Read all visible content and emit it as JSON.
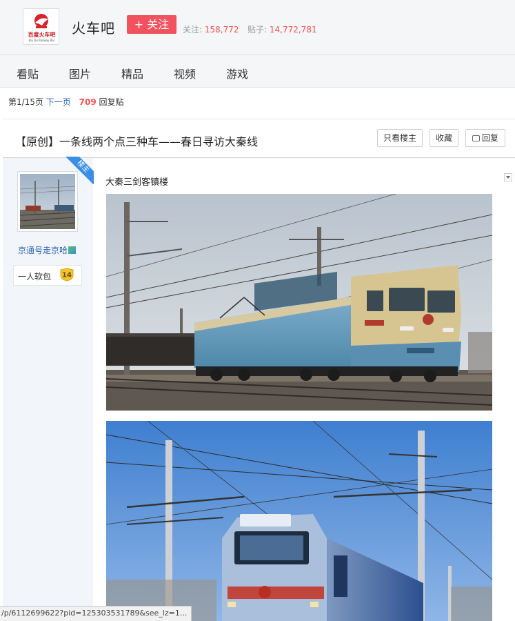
{
  "header": {
    "logo_text": "百度火车吧",
    "logo_subtext": "Bai Du Railway Bar",
    "forum_name": "火车吧",
    "follow_label": "+ 关注",
    "followers_label": "关注:",
    "followers_count": "158,772",
    "posts_label": "贴子:",
    "posts_count": "14,772,781"
  },
  "nav": {
    "items": [
      {
        "label": "看贴"
      },
      {
        "label": "图片"
      },
      {
        "label": "精品"
      },
      {
        "label": "视频"
      },
      {
        "label": "游戏"
      }
    ]
  },
  "pager": {
    "page_info": "第1/15页",
    "next_page": "下一页",
    "reply_count": "709",
    "reply_label": "回复贴"
  },
  "thread": {
    "title": "【原创】一条线两个点三种车——春日寻访大秦线",
    "only_op_label": "只看楼主",
    "favorite_label": "收藏",
    "reply_label": "回复"
  },
  "author": {
    "floor_tag": "楼主",
    "name": "京通号走京哈",
    "level_name": "一人软包",
    "level": "14"
  },
  "post": {
    "caption": "大秦三剑客镇楼"
  },
  "status_bar": {
    "url": "/p/6112699622?pid=125303531789&see_lz=1..."
  },
  "colors": {
    "accent_red": "#f2525d",
    "link_blue": "#2d64b3",
    "count_red": "#f5514f"
  }
}
